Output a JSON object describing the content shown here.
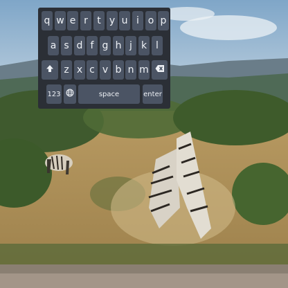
{
  "keyboard": {
    "row1": [
      "q",
      "w",
      "e",
      "r",
      "t",
      "y",
      "u",
      "i",
      "o",
      "p"
    ],
    "row2": [
      "a",
      "s",
      "d",
      "f",
      "g",
      "h",
      "j",
      "k",
      "l"
    ],
    "row3": [
      "z",
      "x",
      "c",
      "v",
      "b",
      "n",
      "m"
    ],
    "shift_icon": "shift-arrow-icon",
    "backspace_icon": "backspace-icon",
    "numbers_label": "123",
    "globe_icon": "globe-icon",
    "space_label": "space",
    "enter_label": "enter"
  }
}
